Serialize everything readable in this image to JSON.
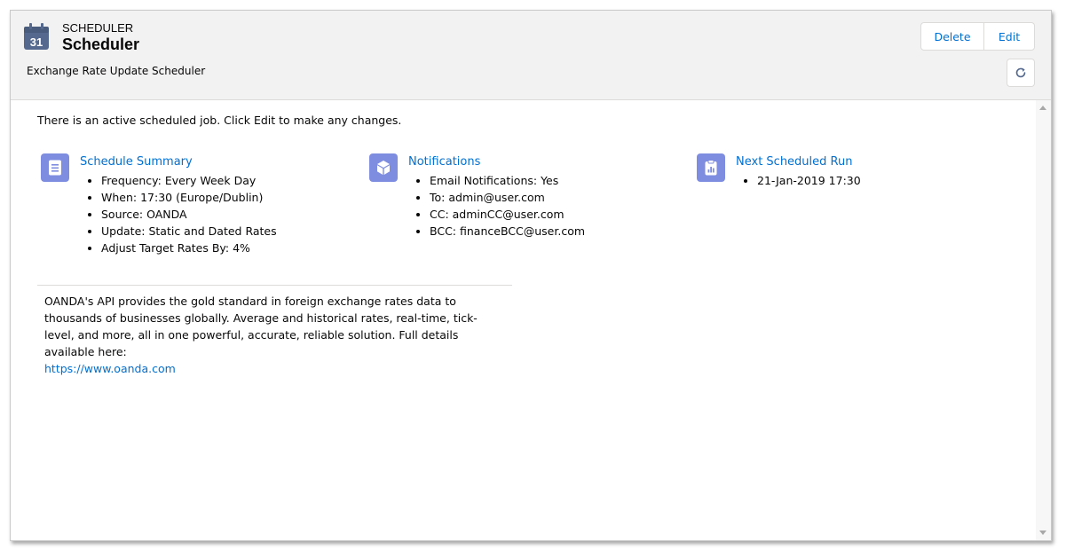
{
  "header": {
    "eyebrow": "SCHEDULER",
    "title": "Scheduler",
    "subtitle": "Exchange Rate Update Scheduler",
    "calendar_day": "31",
    "buttons": {
      "delete_label": "Delete",
      "edit_label": "Edit"
    }
  },
  "body": {
    "intro": "There is an active scheduled job. Click Edit to make any changes.",
    "sections": [
      {
        "title": "Schedule Summary",
        "icon": "document-list-icon",
        "items": [
          "Frequency: Every Week Day",
          "When: 17:30 (Europe/Dublin)",
          "Source: OANDA",
          "Update: Static and Dated Rates",
          "Adjust Target Rates By: 4%"
        ]
      },
      {
        "title": "Notifications",
        "icon": "cube-icon",
        "items": [
          "Email Notifications: Yes",
          "To: admin@user.com",
          "CC: adminCC@user.com",
          "BCC: financeBCC@user.com"
        ]
      },
      {
        "title": "Next Scheduled Run",
        "icon": "clipboard-chart-icon",
        "items": [
          "21-Jan-2019 17:30"
        ]
      }
    ],
    "blurb": {
      "text": "OANDA's API provides the gold standard in foreign exchange rates data to thousands of businesses globally. Average and historical rates, real-time, tick-level, and more, all in one powerful, accurate, reliable solution. Full details available here:",
      "link": "https://www.oanda.com"
    }
  },
  "colors": {
    "link": "#0070d2",
    "section_icon_bg": "#7f8de1",
    "header_bg": "#f3f2f2"
  }
}
